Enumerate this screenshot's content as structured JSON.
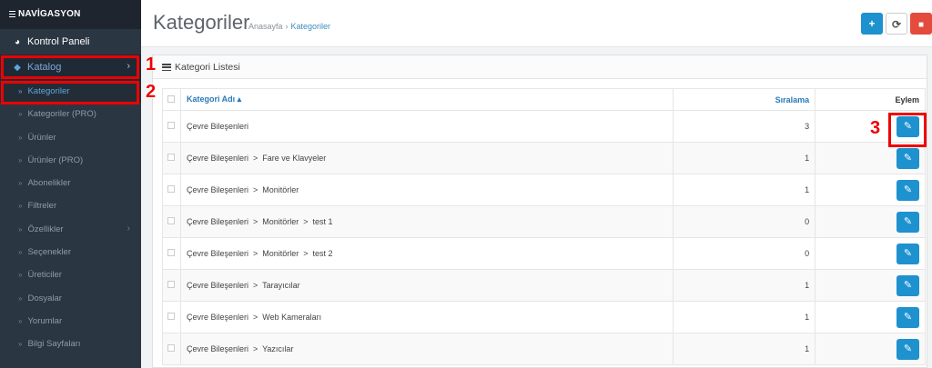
{
  "nav": {
    "header": "NAVİGASYON",
    "dashboard": "Kontrol Paneli",
    "catalog": "Katalog",
    "sub_items": [
      {
        "label": "Kategoriler",
        "active": true
      },
      {
        "label": "Kategoriler (PRO)"
      },
      {
        "label": "Ürünler"
      },
      {
        "label": "Ürünler (PRO)"
      },
      {
        "label": "Abonelikler"
      },
      {
        "label": "Filtreler"
      },
      {
        "label": "Özellikler",
        "has_children": true
      },
      {
        "label": "Seçenekler"
      },
      {
        "label": "Üreticiler"
      },
      {
        "label": "Dosyalar"
      },
      {
        "label": "Yorumlar"
      },
      {
        "label": "Bilgi Sayfaları"
      }
    ]
  },
  "header": {
    "title": "Kategoriler",
    "breadcrumb_home": "Anasayfa",
    "breadcrumb_sep": "›",
    "breadcrumb_current": "Kategoriler",
    "add_icon": "plus-icon",
    "refresh_icon": "refresh-icon",
    "delete_icon": "trash-icon"
  },
  "panel": {
    "title": "Kategori Listesi"
  },
  "table": {
    "col_name": "Kategori Adı ▴",
    "col_sort": "Sıralama",
    "col_action": "Eylem",
    "rows": [
      {
        "name": "Çevre Bileşenleri",
        "sort": "3"
      },
      {
        "name": "Çevre Bileşenleri  >  Fare ve Klavyeler",
        "sort": "1"
      },
      {
        "name": "Çevre Bileşenleri  >  Monitörler",
        "sort": "1"
      },
      {
        "name": "Çevre Bileşenleri  >  Monitörler  >  test 1",
        "sort": "0"
      },
      {
        "name": "Çevre Bileşenleri  >  Monitörler  >  test 2",
        "sort": "0"
      },
      {
        "name": "Çevre Bileşenleri  >  Tarayıcılar",
        "sort": "1"
      },
      {
        "name": "Çevre Bileşenleri  >  Web Kameraları",
        "sort": "1"
      },
      {
        "name": "Çevre Bileşenleri  >  Yazıcılar",
        "sort": "1"
      }
    ]
  },
  "annotations": {
    "one": "1",
    "two": "2",
    "three": "3",
    "color": "#e00000"
  }
}
